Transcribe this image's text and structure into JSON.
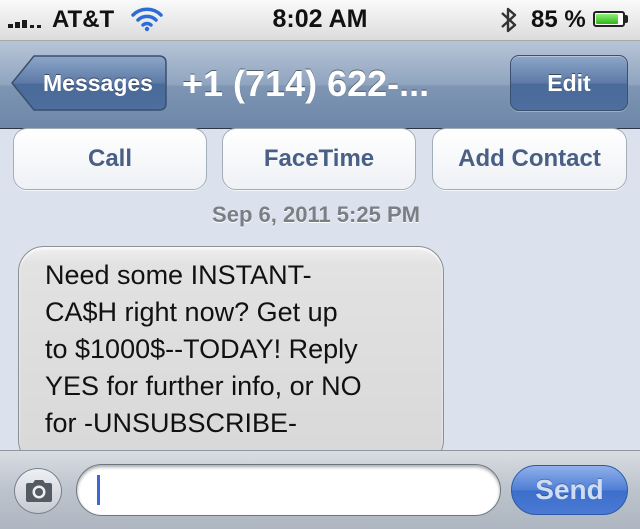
{
  "status_bar": {
    "carrier": "AT&T",
    "time": "8:02 AM",
    "battery_percent": "85 %",
    "battery_level": 0.85,
    "icons": [
      "signal-bars-icon",
      "wifi-icon",
      "bluetooth-icon",
      "battery-icon"
    ]
  },
  "nav_bar": {
    "back_label": "Messages",
    "title": "+1 (714) 622-...",
    "edit_label": "Edit"
  },
  "actions": {
    "call_label": "Call",
    "facetime_label": "FaceTime",
    "add_contact_label": "Add Contact"
  },
  "thread": {
    "timestamp": "Sep 6, 2011 5:25 PM",
    "messages": [
      {
        "direction": "incoming",
        "lines": [
          "Need some INSTANT-",
          "CA$H right now? Get up",
          "to $1000$--TODAY! Reply",
          "YES for further info, or NO",
          "for -UNSUBSCRIBE-"
        ]
      }
    ]
  },
  "composer": {
    "camera_icon": "camera-icon",
    "input_value": "",
    "send_label": "Send"
  },
  "colors": {
    "background": "#dbe2ed",
    "nav_bar": "#7e95b3",
    "action_text": "#4a5f86",
    "send_button": "#4a7ad3",
    "battery_fill": "#2eb514"
  }
}
